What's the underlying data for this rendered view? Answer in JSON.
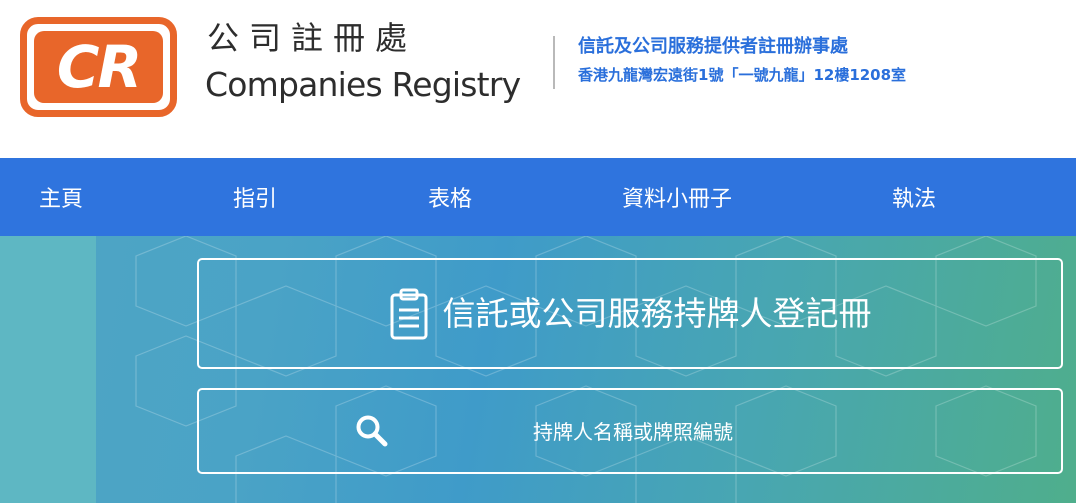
{
  "header": {
    "logo_letters": "CR",
    "logo_name_zh": "公司註冊處",
    "logo_name_en": "Companies Registry",
    "office_name": "信託及公司服務提供者註冊辦事處",
    "office_address": "香港九龍灣宏遠街1號「一號九龍」12樓1208室",
    "brand_color": "#e8662a",
    "text_accent_color": "#2a6fdb"
  },
  "nav": {
    "background_color": "#2f74de",
    "items": [
      {
        "label": "主頁"
      },
      {
        "label": "指引"
      },
      {
        "label": "表格"
      },
      {
        "label": "資料小冊子"
      },
      {
        "label": "執法"
      }
    ]
  },
  "hero": {
    "register_title": "信託或公司服務持牌人登記冊",
    "register_icon": "clipboard-icon",
    "search": {
      "icon": "search-icon",
      "placeholder": "持牌人名稱或牌照編號"
    }
  }
}
